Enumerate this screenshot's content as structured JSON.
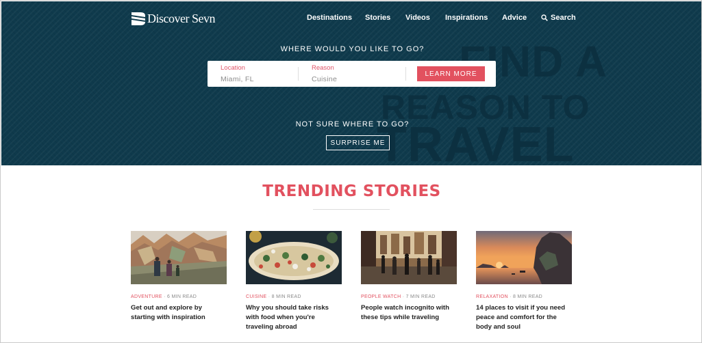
{
  "brand": {
    "name": "Discover Sevn"
  },
  "nav": {
    "items": [
      "Destinations",
      "Stories",
      "Videos",
      "Inspirations",
      "Advice"
    ],
    "search_label": "Search"
  },
  "hero": {
    "question": "WHERE WOULD YOU LIKE TO GO?",
    "location": {
      "label": "Location",
      "value": "Miami, FL"
    },
    "reason": {
      "label": "Reason",
      "value": "Cuisine"
    },
    "cta_label": "LEARN MORE",
    "alt_question": "NOT SURE WHERE TO GO?",
    "surprise_label": "SURPRISE ME",
    "watermark": [
      "FIND A",
      "REASON TO",
      "TRAVEL"
    ]
  },
  "trending": {
    "title": "TRENDING STORIES",
    "cards": [
      {
        "category": "ADVENTURE",
        "read_time": "6 MIN READ",
        "title": "Get out and explore by starting with inspiration",
        "image": "mountain-hikers"
      },
      {
        "category": "CUISINE",
        "read_time": "8 MIN READ",
        "title": "Why you should take risks with food when you're traveling abroad",
        "image": "flatbread-food"
      },
      {
        "category": "PEOPLE WATCH",
        "read_time": "7 MIN READ",
        "title": "People watch incognito with these tips while traveling",
        "image": "city-street-crowd"
      },
      {
        "category": "RELAXATION",
        "read_time": "8 MIN READ",
        "title": "14 places to visit if you need peace and comfort for the body and soul",
        "image": "sunset-bay"
      }
    ]
  },
  "colors": {
    "hero_bg": "#0f3a4c",
    "accent": "#e2515f",
    "text_dark": "#222222"
  }
}
